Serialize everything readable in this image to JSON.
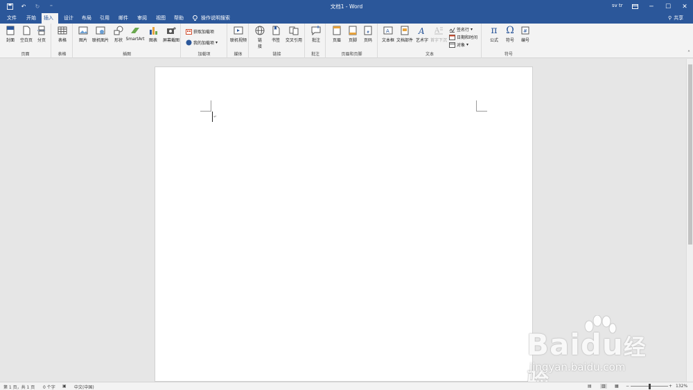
{
  "titlebar": {
    "title": "文档1 - Word",
    "user": "sv tr",
    "qat_more": "⁼"
  },
  "tabs": [
    {
      "label": "文件"
    },
    {
      "label": "开始"
    },
    {
      "label": "插入"
    },
    {
      "label": "设计"
    },
    {
      "label": "布局"
    },
    {
      "label": "引用"
    },
    {
      "label": "邮件"
    },
    {
      "label": "审阅"
    },
    {
      "label": "视图"
    },
    {
      "label": "帮助"
    }
  ],
  "tell_me": "操作说明搜索",
  "share": "共享",
  "ribbon": {
    "pages": {
      "label": "页面",
      "items": [
        "封面",
        "空白页",
        "分页"
      ]
    },
    "tables": {
      "label": "表格",
      "items": [
        "表格"
      ]
    },
    "illustrations": {
      "label": "插图",
      "items": [
        "图片",
        "联机图片",
        "形状",
        "SmartArt",
        "图表",
        "屏幕截图"
      ]
    },
    "addins": {
      "label": "加载项",
      "items": [
        "获取加载项",
        "我的加载项"
      ]
    },
    "media": {
      "label": "媒体",
      "items": [
        "联机视频"
      ]
    },
    "links": {
      "label": "链接",
      "items": [
        "链\n接",
        "书签",
        "交叉引用"
      ]
    },
    "comments": {
      "label": "批注",
      "items": [
        "批注"
      ]
    },
    "header_footer": {
      "label": "页眉和页脚",
      "items": [
        "页眉",
        "页脚",
        "页码"
      ]
    },
    "text": {
      "label": "文本",
      "items": [
        "文本框",
        "文档部件",
        "艺术字",
        "首字下沉"
      ],
      "small": [
        "签名行",
        "日期和时间",
        "对象"
      ]
    },
    "symbols": {
      "label": "符号",
      "items": [
        "公式",
        "符号",
        "编号"
      ]
    }
  },
  "status": {
    "page": "第 1 页，共 1 页",
    "words": "0 个字",
    "lang": "中文(中国)",
    "zoom": "132%"
  },
  "watermark": {
    "brand": "Bai",
    "cn": "经验",
    "url": "jingyan.baidu.com"
  },
  "colors": {
    "accent": "#2b579a"
  }
}
